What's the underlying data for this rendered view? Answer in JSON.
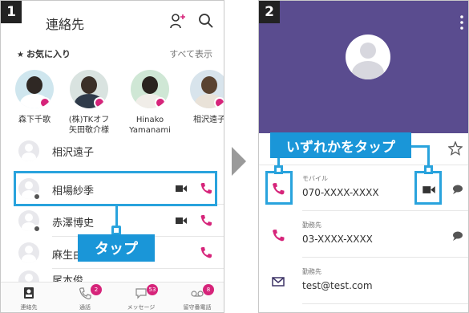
{
  "colors": {
    "accent_pink": "#d6247a",
    "callout_blue": "#1a96d8",
    "highlight_blue": "#29a3dd",
    "header_purple": "#5a4c8f"
  },
  "panel1": {
    "step": "1",
    "title": "連絡先",
    "favorites_label": "お気に入り",
    "show_all": "すべて表示",
    "favorites": [
      {
        "name": "森下千歌"
      },
      {
        "name": "(株)TKオフ\n矢田敬介様"
      },
      {
        "name": "Hinako\nYamanami"
      },
      {
        "name": "相沢遠子"
      }
    ],
    "contacts": [
      {
        "name": "相沢遠子"
      },
      {
        "name": "相場紗季"
      },
      {
        "name": "赤澤博史"
      },
      {
        "name": "麻生由"
      },
      {
        "name": "尾本俊"
      }
    ],
    "tap_label": "タップ",
    "tabs": [
      {
        "label": "連絡先",
        "icon": "contacts-icon",
        "badge": ""
      },
      {
        "label": "通話",
        "icon": "phone-icon",
        "badge": "2"
      },
      {
        "label": "メッセージ",
        "icon": "message-icon",
        "badge": "53"
      },
      {
        "label": "留守番電話",
        "icon": "voicemail-icon",
        "badge": "8"
      }
    ]
  },
  "panel2": {
    "step": "2",
    "callout": "いずれかをタップ",
    "rows": [
      {
        "sub": "モバイル",
        "value": "070-XXXX-XXXX",
        "icon": "phone-icon"
      },
      {
        "sub": "勤務先",
        "value": "03-XXXX-XXXX",
        "icon": "phone-icon"
      },
      {
        "sub": "勤務先",
        "value": "test@test.com",
        "icon": "mail-icon"
      }
    ]
  }
}
